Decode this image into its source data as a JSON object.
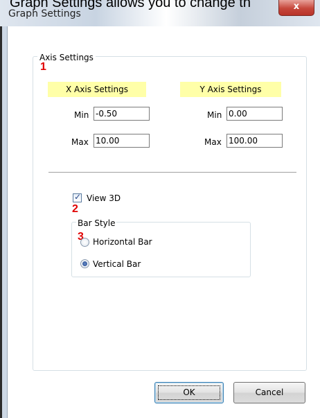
{
  "caption": "Graph Settings allows you to change th",
  "window": {
    "title": "Graph Settings",
    "close_glyph": "x"
  },
  "axis_group": {
    "legend": "Axis Settings",
    "x_axis": {
      "header": "X Axis Settings",
      "min_label": "Min",
      "min_value": "-0.50",
      "max_label": "Max",
      "max_value": "10.00"
    },
    "y_axis": {
      "header": "Y Axis Settings",
      "min_label": "Min",
      "min_value": "0.00",
      "max_label": "Max",
      "max_value": "100.00"
    }
  },
  "view3d": {
    "label": "View 3D",
    "checked": true
  },
  "bar_style": {
    "legend": "Bar Style",
    "options": [
      {
        "label": "Horizontal Bar",
        "selected": false
      },
      {
        "label": "Vertical Bar",
        "selected": true
      }
    ]
  },
  "markers": [
    "1",
    "2",
    "3"
  ],
  "buttons": {
    "ok": "OK",
    "cancel": "Cancel"
  },
  "colors": {
    "header_highlight": "#ffffa8",
    "marker": "#e00000",
    "close_button": "#c6473b"
  }
}
